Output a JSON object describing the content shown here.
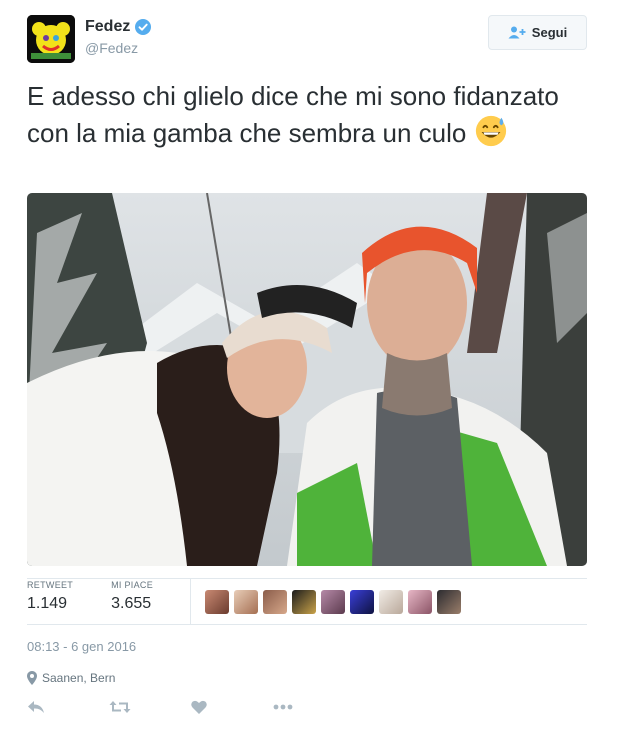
{
  "user": {
    "display_name": "Fedez",
    "screen_name": "@Fedez"
  },
  "follow_button": {
    "label": "Segui",
    "icon": "add-user-icon"
  },
  "tweet": {
    "text": "E adesso chi glielo dice che mi sono fidanzato con la mia gamba che sembra un culo",
    "emoji": "grinning-face-with-sweat"
  },
  "stats": {
    "retweets_label": "RETWEET",
    "retweets": "1.149",
    "likes_label": "MI PIACE",
    "likes": "3.655"
  },
  "likers_count": 9,
  "timestamp": "08:13 - 6 gen 2016",
  "location": "Saanen, Bern",
  "actions": [
    "reply-icon",
    "retweet-icon",
    "heart-icon",
    "more-icon"
  ],
  "colors": {
    "text": "#292f33",
    "muted": "#8899a6",
    "verified": "#55acee",
    "border": "#e1e8ed",
    "action": "#aab8c2"
  }
}
